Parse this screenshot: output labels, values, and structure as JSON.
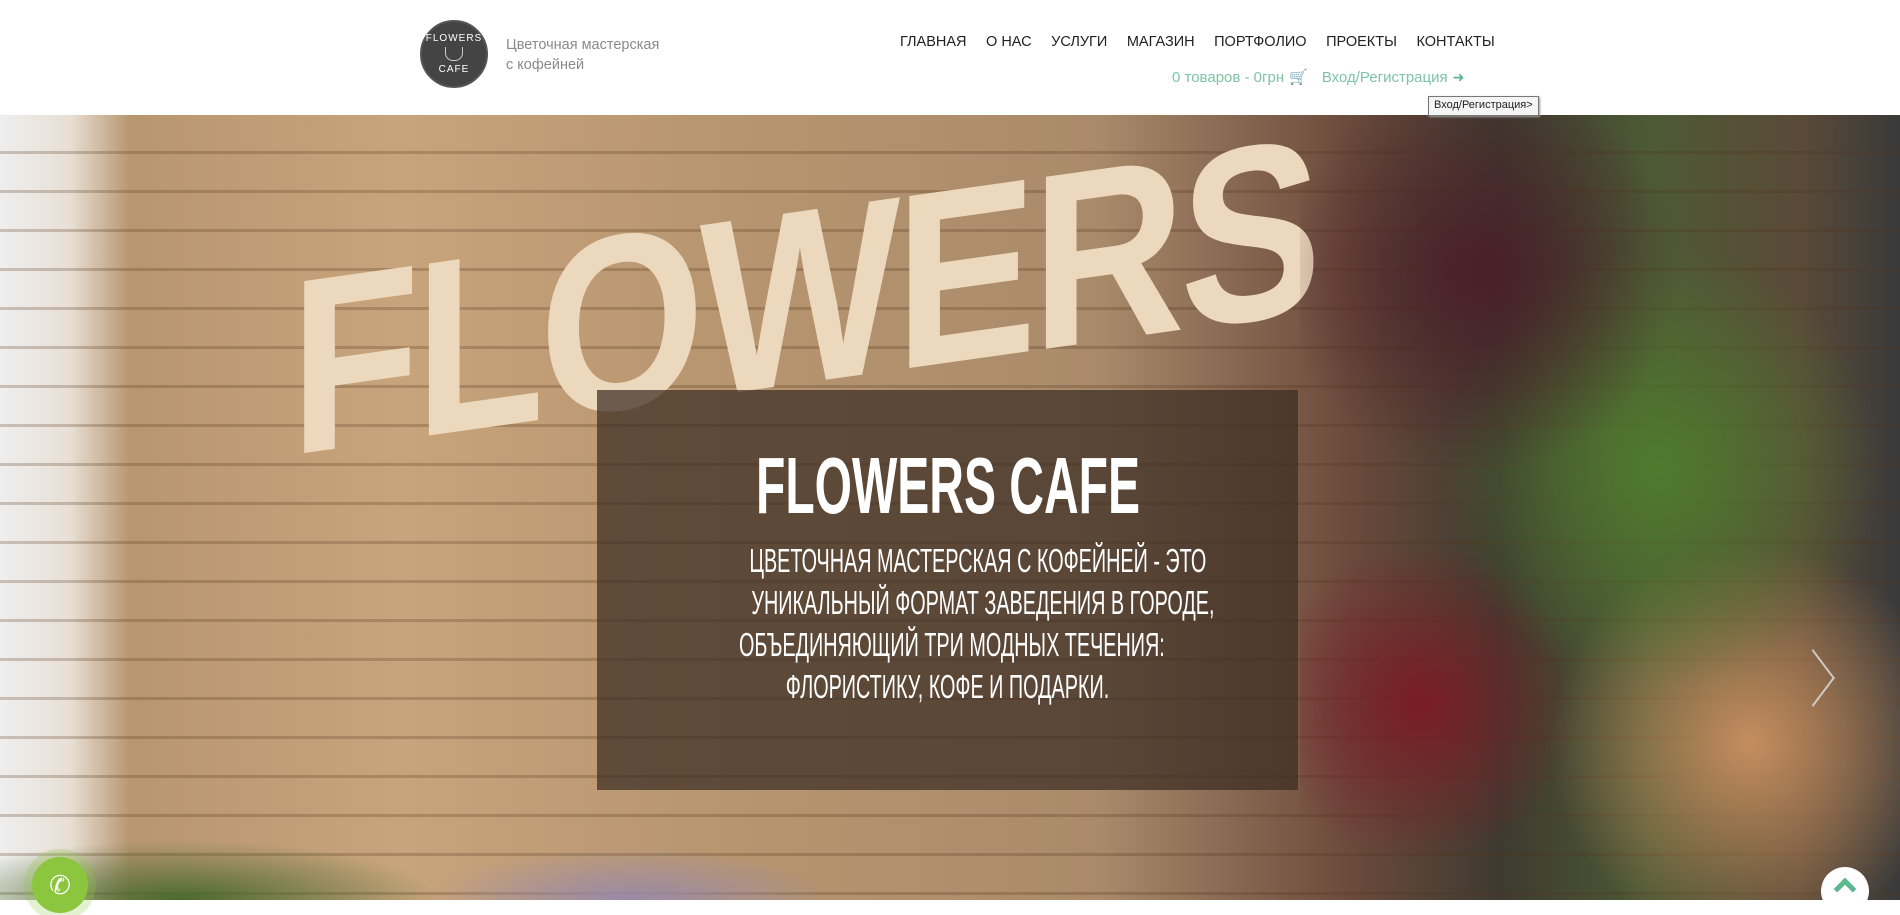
{
  "header": {
    "logo": {
      "top_text": "FLOWERS",
      "bottom_text": "CAFE"
    },
    "tagline": [
      "Цветочная мастерская",
      "с кофейней"
    ],
    "nav": [
      "ГЛАВНАЯ",
      "О НАС",
      "УСЛУГИ",
      "МАГАЗИН",
      "ПОРТФОЛИО",
      "ПРОЕКТЫ",
      "КОНТАКТЫ"
    ],
    "cart_label": "0 товаров - 0грн",
    "login_label": "Вход/Регистрация",
    "tooltip": "Вход/Регистрация>"
  },
  "hero": {
    "background_word": "FLOWERS",
    "title": "FLOWERS CAFE",
    "body_lines": [
      "ЦВЕТОЧНАЯ МАСТЕРСКАЯ С КОФЕЙНЕЙ - ЭТО",
      "УНИКАЛЬНЫЙ ФОРМАТ ЗАВЕДЕНИЯ В ГОРОДЕ,",
      "ОБЪЕДИНЯЮЩИЙ ТРИ МОДНЫХ ТЕЧЕНИЯ:",
      "ФЛОРИСТИКУ, КОФЕ И ПОДАРКИ."
    ]
  },
  "icons": {
    "cart": "shopping-cart-icon",
    "login": "sign-in-icon",
    "phone": "phone-icon",
    "up": "chevron-up-icon",
    "next": "chevron-right-icon"
  },
  "colors": {
    "accent": "#5cb88e",
    "phone_button": "#8cc63f"
  }
}
